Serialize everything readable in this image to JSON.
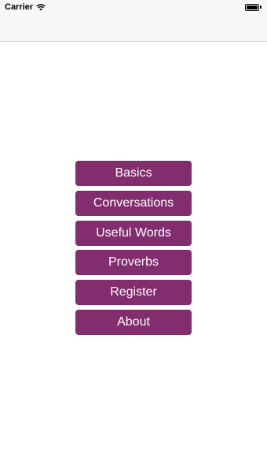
{
  "status_bar": {
    "carrier": "Carrier",
    "icons": [
      "wifi-icon",
      "battery-icon"
    ]
  },
  "colors": {
    "button_background": "#812d6e",
    "button_text": "#ffffff",
    "bar_background": "#f7f7f7"
  },
  "menu": {
    "items": [
      {
        "label": "Basics"
      },
      {
        "label": "Conversations"
      },
      {
        "label": "Useful Words"
      },
      {
        "label": "Proverbs"
      },
      {
        "label": "Register"
      },
      {
        "label": "About"
      }
    ]
  }
}
